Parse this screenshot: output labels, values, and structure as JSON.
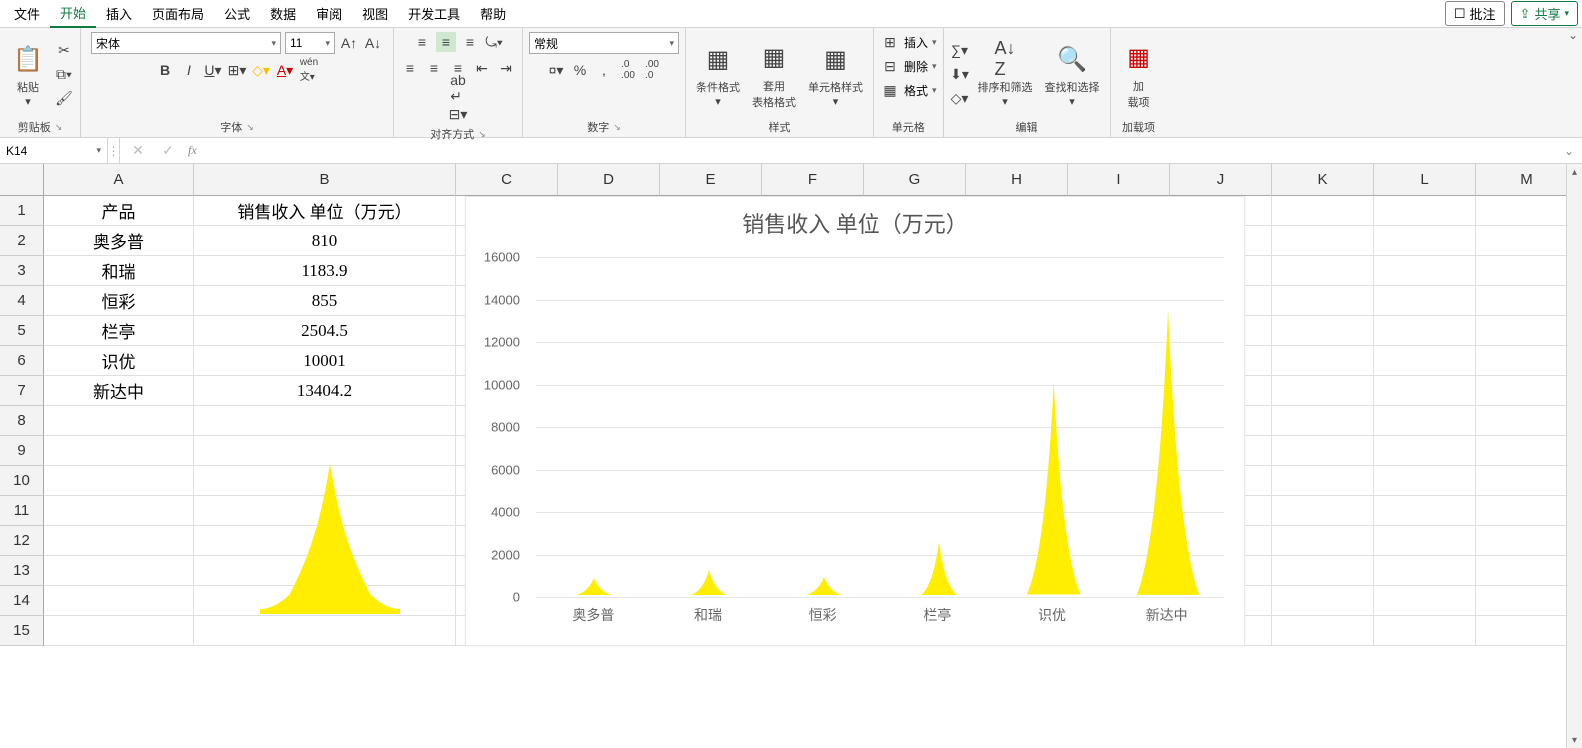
{
  "tabs": {
    "file": "文件",
    "home": "开始",
    "insert": "插入",
    "layout": "页面布局",
    "formulas": "公式",
    "data": "数据",
    "review": "审阅",
    "view": "视图",
    "dev": "开发工具",
    "help": "帮助",
    "comments": "批注",
    "share": "共享"
  },
  "ribbon": {
    "clipboard": {
      "paste": "粘贴",
      "label": "剪贴板"
    },
    "font": {
      "name": "宋体",
      "size": "11",
      "label": "字体"
    },
    "align": {
      "label": "对齐方式",
      "wrap_tip": "自动换行",
      "merge_tip": "合并后居中"
    },
    "number": {
      "format": "常规",
      "label": "数字"
    },
    "styles": {
      "cond": "条件格式",
      "table": "套用\n表格格式",
      "cell": "单元格样式",
      "label": "样式"
    },
    "cells": {
      "insert": "插入",
      "delete": "删除",
      "format": "格式",
      "label": "单元格"
    },
    "editing": {
      "sort": "排序和筛选",
      "find": "查找和选择",
      "label": "编辑"
    },
    "addins": {
      "btn": "加\n载项",
      "label": "加载项"
    }
  },
  "formula_bar": {
    "name": "K14",
    "fx": "fx"
  },
  "sheet": {
    "col_widths": {
      "A": 150,
      "B": 262,
      "other": 102
    },
    "columns": [
      "A",
      "B",
      "C",
      "D",
      "E",
      "F",
      "G",
      "H",
      "I",
      "J",
      "K",
      "L",
      "M"
    ],
    "rows": [
      1,
      2,
      3,
      4,
      5,
      6,
      7,
      8,
      9,
      10,
      11,
      12,
      13,
      14,
      15
    ],
    "header": {
      "A": "产品",
      "B": "销售收入 单位（万元）"
    },
    "data": [
      {
        "A": "奥多普",
        "B": "810"
      },
      {
        "A": "和瑞",
        "B": "1183.9"
      },
      {
        "A": "恒彩",
        "B": "855"
      },
      {
        "A": "栏亭",
        "B": "2504.5"
      },
      {
        "A": "识优",
        "B": "10001"
      },
      {
        "A": "新达中",
        "B": "13404.2"
      }
    ]
  },
  "chart_data": {
    "type": "bar",
    "title": "销售收入 单位（万元）",
    "categories": [
      "奥多普",
      "和瑞",
      "恒彩",
      "栏亭",
      "识优",
      "新达中"
    ],
    "values": [
      810,
      1183.9,
      855,
      2504.5,
      10001,
      13404.2
    ],
    "ylim": [
      0,
      16000
    ],
    "yticks": [
      0,
      2000,
      4000,
      6000,
      8000,
      10000,
      12000,
      14000,
      16000
    ],
    "xlabel": "",
    "ylabel": ""
  }
}
